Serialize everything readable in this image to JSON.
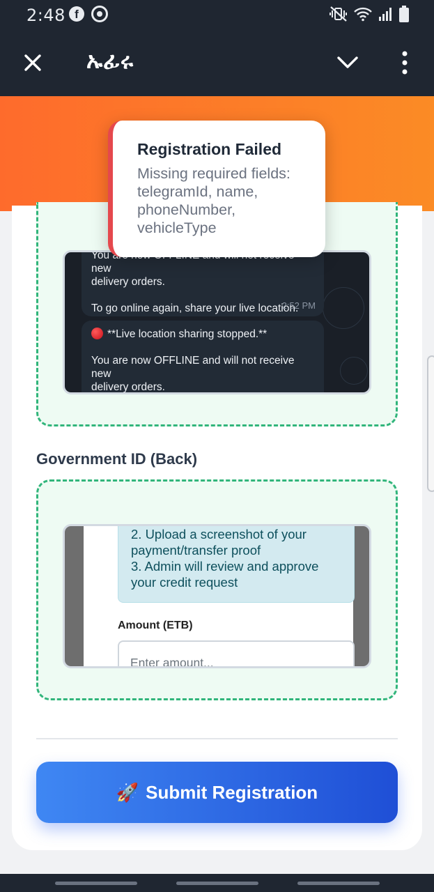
{
  "status_bar": {
    "time": "2:48",
    "left_icons": [
      "facebook-icon",
      "messenger-icon"
    ],
    "right_icons": [
      "mute-vibrate-icon",
      "wifi-icon",
      "signal-icon",
      "battery-icon"
    ]
  },
  "app_bar": {
    "title": "ኡፊሩ",
    "icons": [
      "close-icon",
      "chevron-down-icon",
      "more-vert-icon"
    ]
  },
  "toast": {
    "title": "Registration Failed",
    "message": "Missing required fields:\ntelegramId, name,\nphoneNumber,\nvehicleType",
    "accent": "#e5484d"
  },
  "upload_front": {
    "messages": [
      {
        "text": "You are now OFFLINE and will not receive new\ndelivery orders.\n\nTo go online again, share your live location.",
        "time": "2:52 PM"
      },
      {
        "text": "**Live location sharing stopped.**\n\nYou are now OFFLINE and will not receive new\ndelivery orders."
      }
    ]
  },
  "upload_back": {
    "label": "Government ID (Back)",
    "info_lines": "2. Upload a screenshot of your\npayment/transfer proof\n3. Admin will review and approve\nyour credit request",
    "amount_label": "Amount (ETB)",
    "amount_placeholder": "Enter amount..."
  },
  "submit": {
    "label": "Submit Registration",
    "icon": "rocket-icon"
  },
  "colors": {
    "header_bg": "#1f2631",
    "banner_from": "#fe6b2c",
    "banner_to": "#fb8b25",
    "dashed_border": "#31b57b",
    "button_from": "#3f87f3",
    "button_to": "#1f4fd6"
  }
}
